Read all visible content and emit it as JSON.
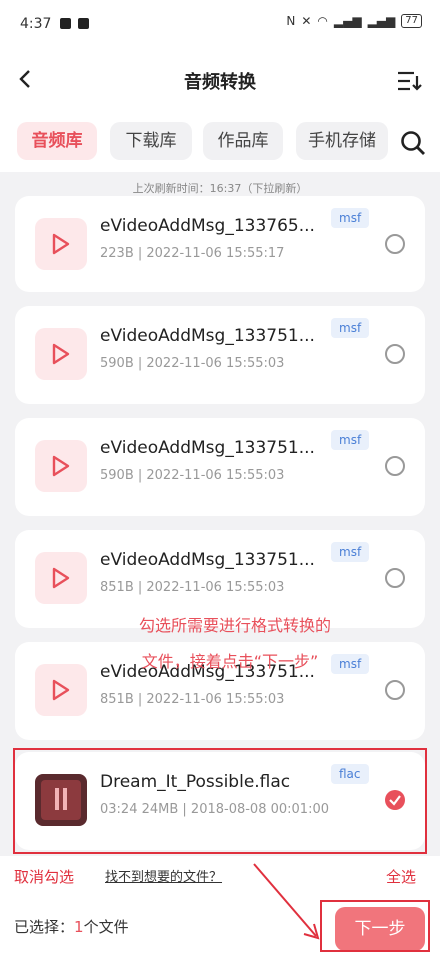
{
  "status": {
    "time": "4:37",
    "battery": "77"
  },
  "header": {
    "title": "音频转换"
  },
  "tabs": [
    {
      "label": "音频库"
    },
    {
      "label": "下载库"
    },
    {
      "label": "作品库"
    },
    {
      "label": "手机存储"
    }
  ],
  "refresh_text": "上次刷新时间：16:37（下拉刷新）",
  "files": [
    {
      "name": "eVideoAddMsg_133765...",
      "meta": "223B | 2022-11-06 15:55:17",
      "ext": "msf",
      "selected": false
    },
    {
      "name": "eVideoAddMsg_133751...",
      "meta": "590B | 2022-11-06 15:55:03",
      "ext": "msf",
      "selected": false
    },
    {
      "name": "eVideoAddMsg_133751...",
      "meta": "590B | 2022-11-06 15:55:03",
      "ext": "msf",
      "selected": false
    },
    {
      "name": "eVideoAddMsg_133751...",
      "meta": "851B | 2022-11-06 15:55:03",
      "ext": "msf",
      "selected": false
    },
    {
      "name": "eVideoAddMsg_133751...",
      "meta": "851B | 2022-11-06 15:55:03",
      "ext": "msf",
      "selected": false
    },
    {
      "name": "Dream_It_Possible.flac",
      "meta": "03:24 24MB | 2018-08-08 00:01:00",
      "ext": "flac",
      "selected": true
    }
  ],
  "annotation": {
    "line1": "勾选所需要进行格式转换的",
    "line2": "文件，接着点击“下一步”"
  },
  "bottom": {
    "cancel_label": "取消勾选",
    "not_found_label": "找不到想要的文件？",
    "select_all_label": "全选",
    "selected_prefix": "已选择：",
    "selected_count": "1",
    "selected_suffix": "个文件",
    "next_label": "下一步"
  },
  "colors": {
    "accent": "#e8505b",
    "annotation": "#e0303e"
  }
}
